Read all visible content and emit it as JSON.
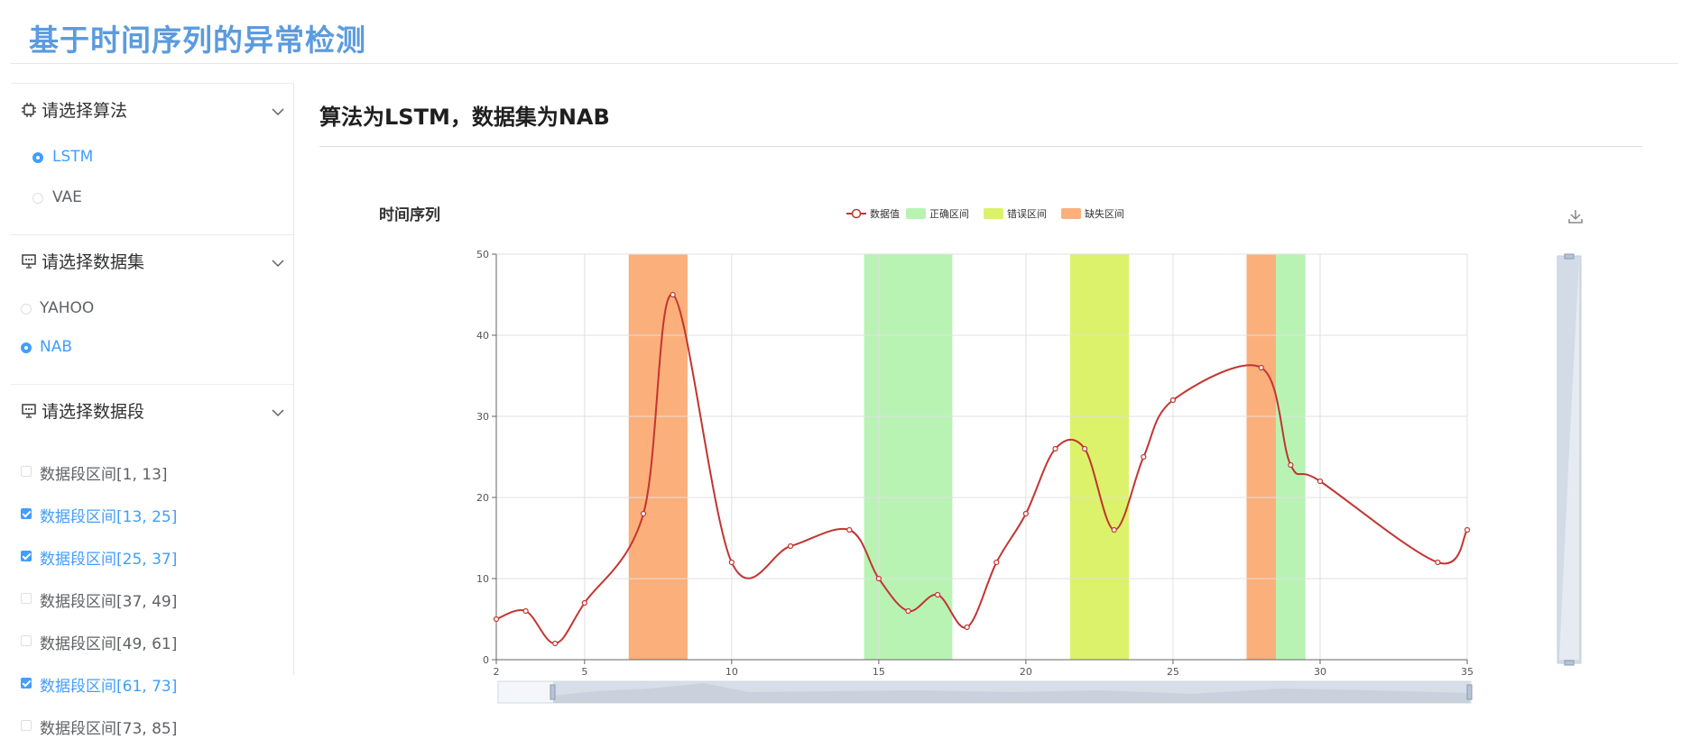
{
  "header": {
    "title": "基于时间序列的异常检测"
  },
  "sidebar": {
    "algorithm": {
      "title": "请选择算法",
      "icon": "chip-icon",
      "options": [
        {
          "label": "LSTM",
          "selected": true
        },
        {
          "label": "VAE",
          "selected": false
        }
      ]
    },
    "dataset": {
      "title": "请选择数据集",
      "icon": "presentation-icon",
      "options": [
        {
          "label": "YAHOO",
          "selected": false
        },
        {
          "label": "NAB",
          "selected": true
        }
      ]
    },
    "segments": {
      "title": "请选择数据段",
      "icon": "presentation-icon",
      "options": [
        {
          "label": "数据段区间[1, 13]",
          "checked": false
        },
        {
          "label": "数据段区间[13, 25]",
          "checked": true
        },
        {
          "label": "数据段区间[25, 37]",
          "checked": true
        },
        {
          "label": "数据段区间[37, 49]",
          "checked": false
        },
        {
          "label": "数据段区间[49, 61]",
          "checked": false
        },
        {
          "label": "数据段区间[61, 73]",
          "checked": true
        },
        {
          "label": "数据段区间[73, 85]",
          "checked": false
        }
      ]
    }
  },
  "main": {
    "heading": "算法为LSTM，数据集为NAB"
  },
  "chart_data": {
    "type": "line",
    "title": "时间序列",
    "legend": [
      "数据值",
      "正确区间",
      "错误区间",
      "缺失区间"
    ],
    "legend_position": "top-center",
    "colors": {
      "line": "#c23531",
      "correct": "#b8f3b4",
      "error": "#dcf26a",
      "missing": "#fbaf7b",
      "grid": "#e0e0e0",
      "axis": "#666666"
    },
    "xlim": [
      2,
      35
    ],
    "ylim": [
      0,
      50
    ],
    "x_ticks": [
      2,
      5,
      10,
      15,
      20,
      25,
      30,
      35
    ],
    "y_ticks": [
      0,
      10,
      20,
      30,
      40,
      50
    ],
    "grid": true,
    "series": [
      {
        "name": "数据值",
        "x": [
          2,
          3,
          4,
          5,
          7,
          8,
          10,
          12,
          14,
          15,
          16,
          17,
          18,
          19,
          20,
          21,
          22,
          23,
          24,
          25,
          28,
          29,
          30,
          34,
          35
        ],
        "y": [
          5,
          6,
          2,
          7,
          18,
          45,
          12,
          14,
          16,
          10,
          6,
          8,
          4,
          12,
          18,
          26,
          26,
          16,
          25,
          32,
          36,
          24,
          22,
          12,
          16
        ]
      }
    ],
    "bands": [
      {
        "type": "missing",
        "from": 6.5,
        "to": 8.5
      },
      {
        "type": "correct",
        "from": 14.5,
        "to": 17.5
      },
      {
        "type": "error",
        "from": 21.5,
        "to": 23.5
      },
      {
        "type": "missing",
        "from": 27.5,
        "to": 28.5
      },
      {
        "type": "correct",
        "from": 28.5,
        "to": 29.5
      }
    ]
  }
}
